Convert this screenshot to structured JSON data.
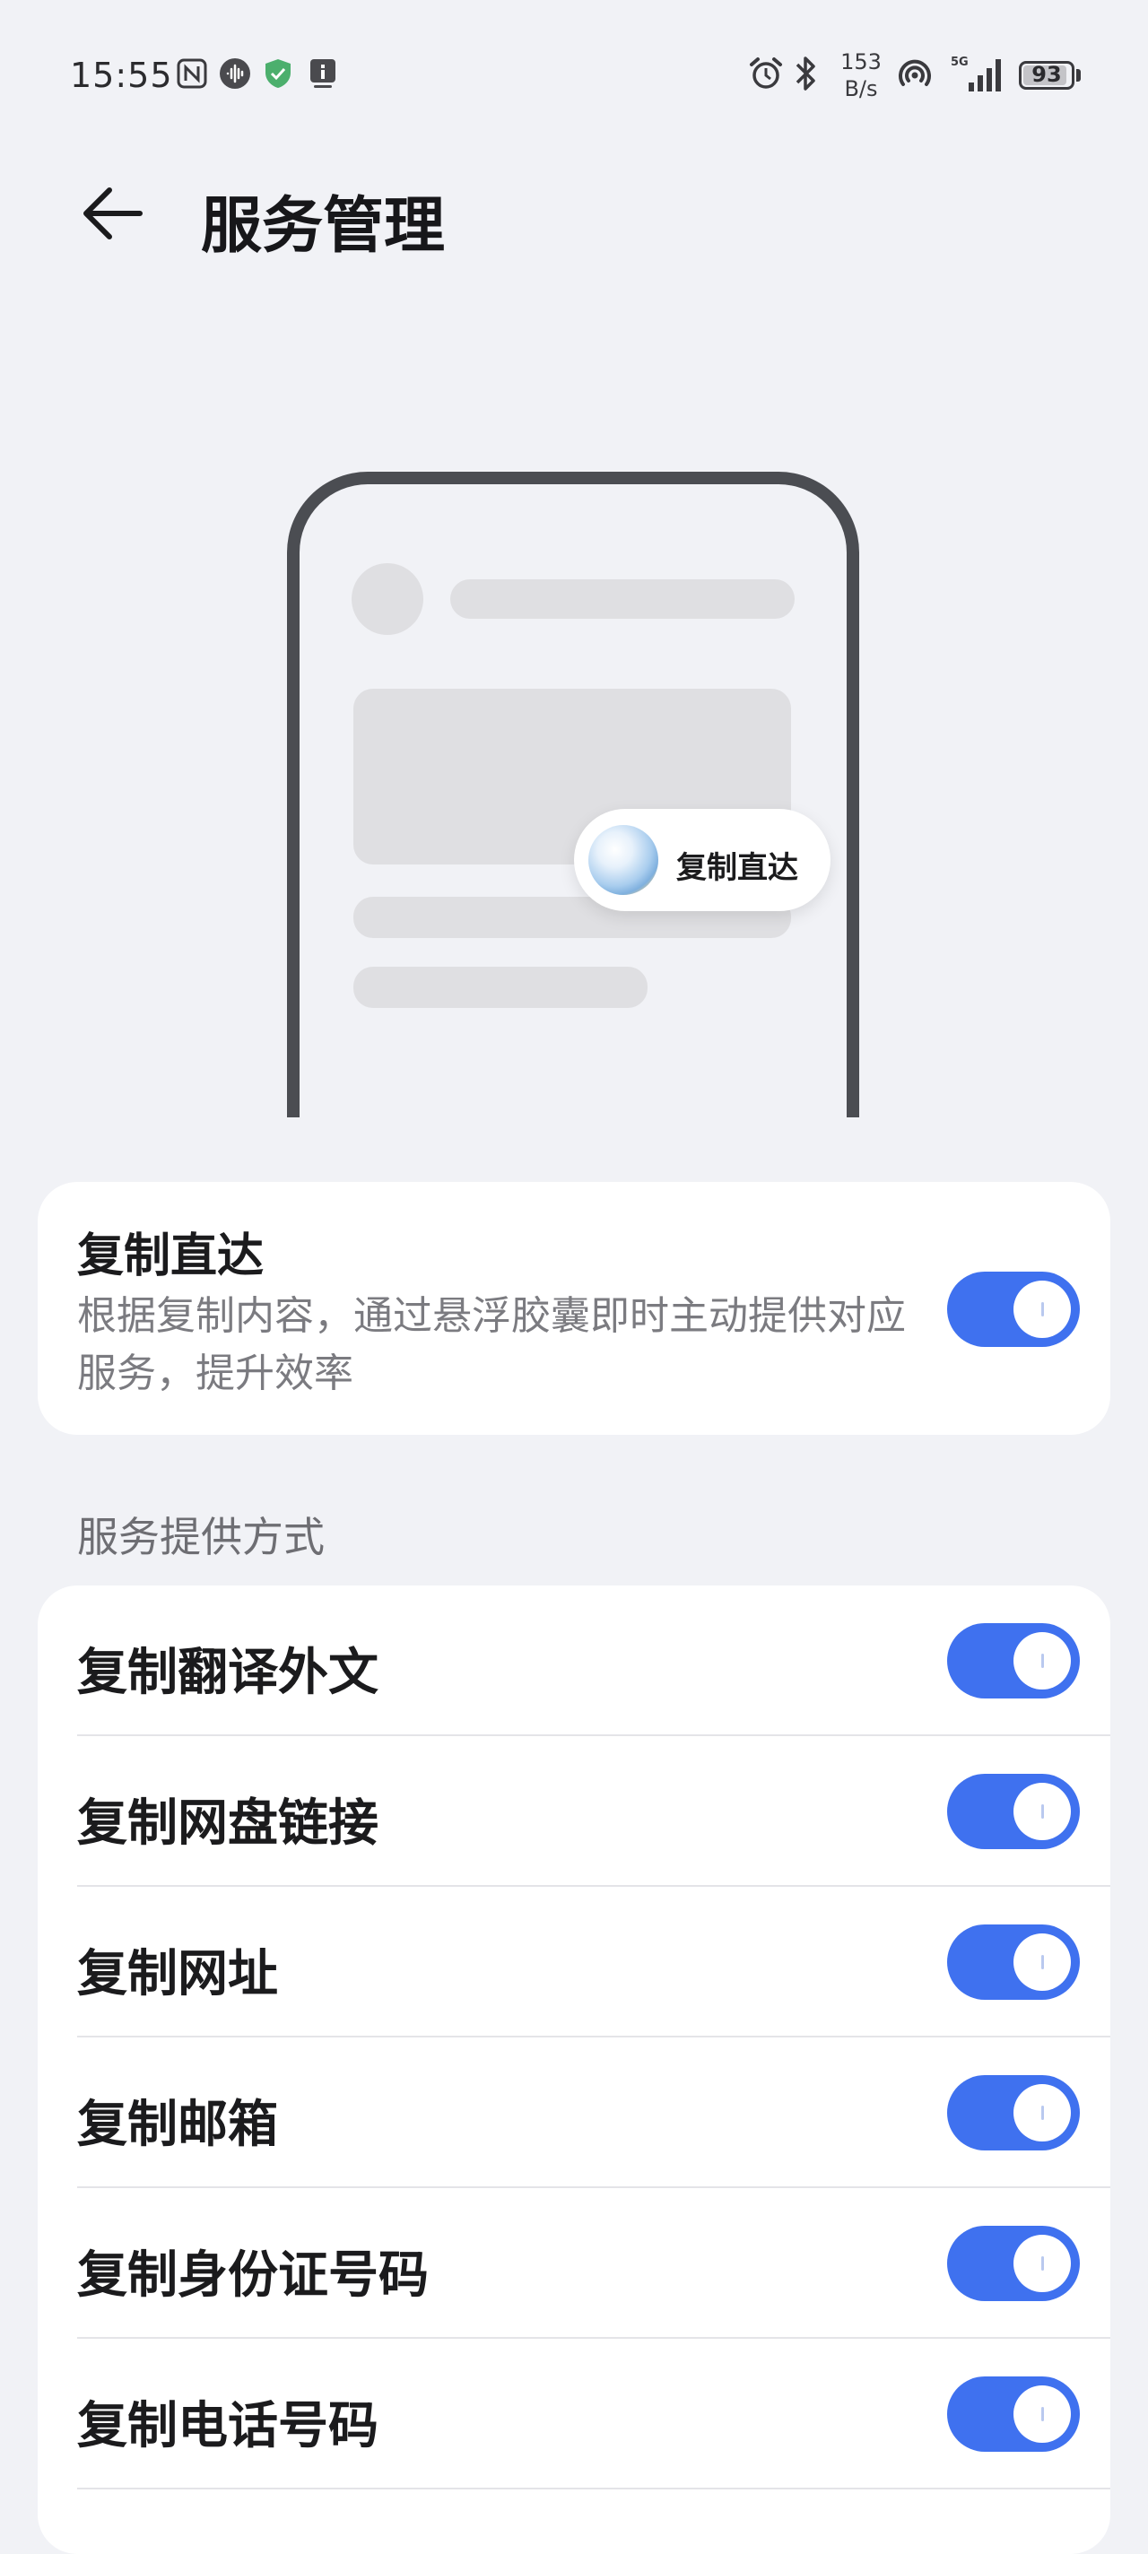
{
  "status_bar": {
    "time": "15:55",
    "net_speed_value": "153",
    "net_speed_unit": "B/s",
    "battery": "93",
    "battery_level": 0.93,
    "network_label": "5G",
    "icons": [
      "nfc-icon",
      "voice-wave-icon",
      "shield-check-icon",
      "notification-icon",
      "alarm-icon",
      "bluetooth-icon",
      "hotspot-icon",
      "signal-icon",
      "battery-icon"
    ]
  },
  "header": {
    "title": "服务管理",
    "back_icon": "arrow-left-icon"
  },
  "illustration": {
    "capsule_label": "复制直达"
  },
  "main_setting": {
    "title": "复制直达",
    "description": "根据复制内容，通过悬浮胶囊即时主动提供对应服务，提升效率",
    "enabled": true
  },
  "section": {
    "label": "服务提供方式"
  },
  "options": [
    {
      "label": "复制翻译外文",
      "enabled": true
    },
    {
      "label": "复制网盘链接",
      "enabled": true
    },
    {
      "label": "复制网址",
      "enabled": true
    },
    {
      "label": "复制邮箱",
      "enabled": true
    },
    {
      "label": "复制身份证号码",
      "enabled": true
    },
    {
      "label": "复制电话号码",
      "enabled": true
    }
  ],
  "colors": {
    "accent": "#3f71ef",
    "background": "#f1f2f6",
    "card": "#ffffff"
  }
}
